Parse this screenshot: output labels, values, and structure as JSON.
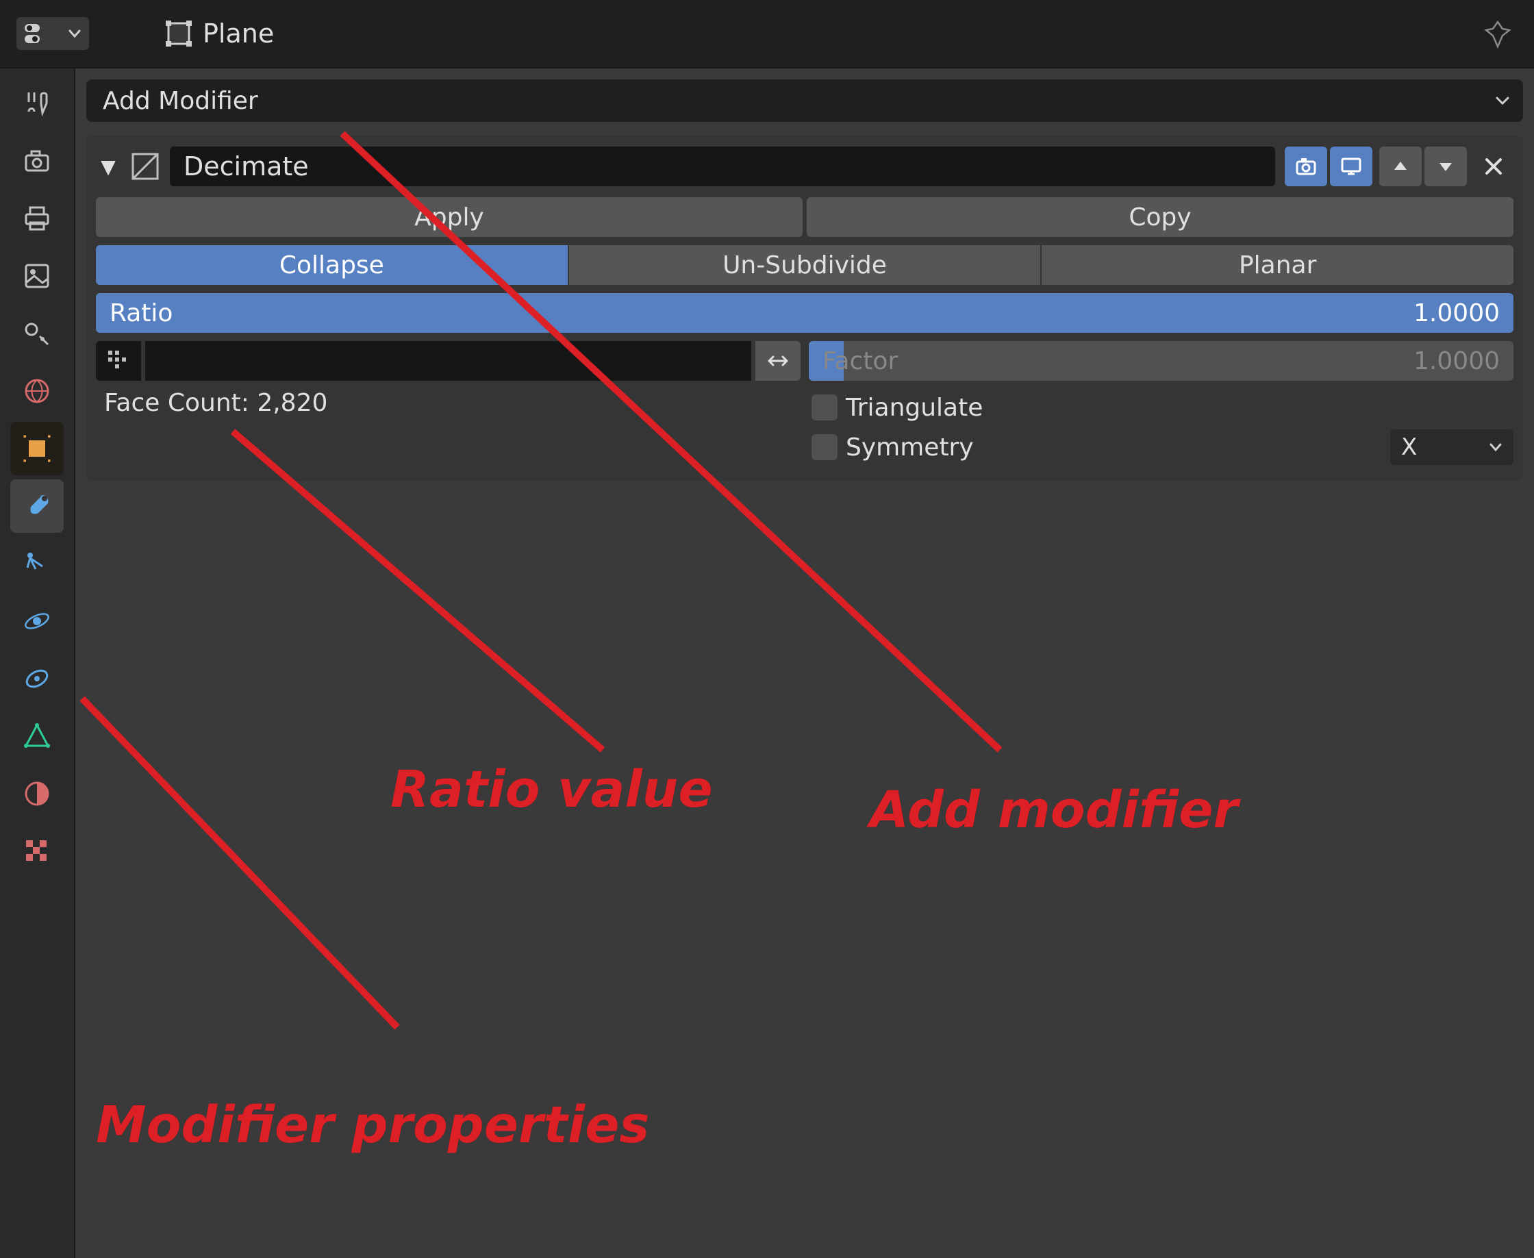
{
  "header": {
    "object_name": "Plane"
  },
  "add_modifier": {
    "label": "Add Modifier"
  },
  "modifier": {
    "name": "Decimate",
    "apply_label": "Apply",
    "copy_label": "Copy",
    "mode": {
      "collapse": "Collapse",
      "unsubdivide": "Un-Subdivide",
      "planar": "Planar",
      "active": "collapse"
    },
    "ratio_label": "Ratio",
    "ratio_value": "1.0000",
    "factor_label": "Factor",
    "factor_value": "1.0000",
    "triangulate_label": "Triangulate",
    "symmetry_label": "Symmetry",
    "symmetry_axis": "X",
    "face_count_label": "Face Count: 2,820"
  },
  "annotations": {
    "ratio": "Ratio value",
    "add_modifier": "Add modifier",
    "modifier_properties": "Modifier properties"
  },
  "tabs": [
    {
      "id": "tool",
      "color": "#c0c0c0"
    },
    {
      "id": "render",
      "color": "#c0c0c0"
    },
    {
      "id": "output",
      "color": "#c0c0c0"
    },
    {
      "id": "viewlayer",
      "color": "#c0c0c0"
    },
    {
      "id": "scene",
      "color": "#c0c0c0"
    },
    {
      "id": "world",
      "color": "#d76a6a"
    },
    {
      "id": "object",
      "color": "#e6a048"
    },
    {
      "id": "modifiers",
      "color": "#5ea8e8"
    },
    {
      "id": "particles",
      "color": "#5ea8e8"
    },
    {
      "id": "physics",
      "color": "#5ea8e8"
    },
    {
      "id": "constraints",
      "color": "#5ea8e8"
    },
    {
      "id": "mesh",
      "color": "#2ecc9a"
    },
    {
      "id": "material",
      "color": "#d76a6a"
    },
    {
      "id": "texture",
      "color": "#d76a6a"
    }
  ]
}
